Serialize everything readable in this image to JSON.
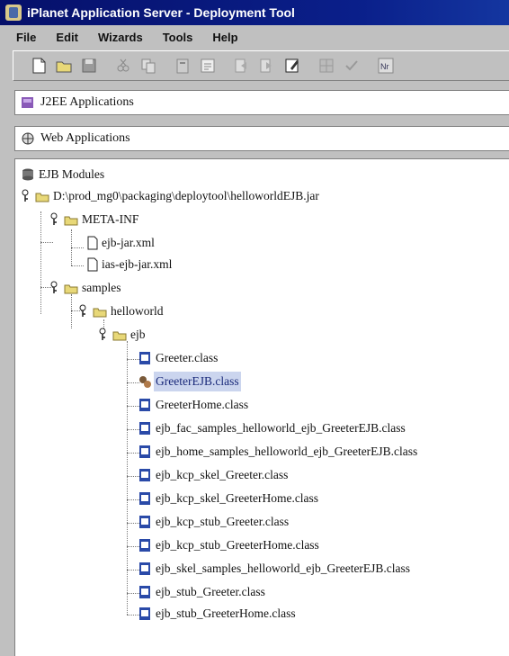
{
  "window": {
    "title": "iPlanet Application Server - Deployment Tool"
  },
  "menubar": {
    "items": [
      "File",
      "Edit",
      "Wizards",
      "Tools",
      "Help"
    ]
  },
  "toolbar": {
    "buttons": [
      "new-icon",
      "open-icon",
      "save-icon",
      "cut-icon",
      "copy-icon",
      "paste-icon",
      "compose-icon",
      "back-icon",
      "forward-icon",
      "edit-icon",
      "grid-icon",
      "check-icon",
      "deploy-icon"
    ]
  },
  "panels": {
    "j2ee": "J2EE Applications",
    "web": "Web Applications"
  },
  "tree": {
    "root": "EJB Modules",
    "jar": "D:\\prod_mg0\\packaging\\deploytool\\helloworldEJB.jar",
    "meta_inf": "META-INF",
    "meta_files": [
      "ejb-jar.xml",
      "ias-ejb-jar.xml"
    ],
    "samples": "samples",
    "helloworld": "helloworld",
    "ejb": "ejb",
    "selected": "GreeterEJB.class",
    "classes": [
      "Greeter.class",
      "GreeterEJB.class",
      "GreeterHome.class",
      "ejb_fac_samples_helloworld_ejb_GreeterEJB.class",
      "ejb_home_samples_helloworld_ejb_GreeterEJB.class",
      "ejb_kcp_skel_Greeter.class",
      "ejb_kcp_skel_GreeterHome.class",
      "ejb_kcp_stub_Greeter.class",
      "ejb_kcp_stub_GreeterHome.class",
      "ejb_skel_samples_helloworld_ejb_GreeterEJB.class",
      "ejb_stub_Greeter.class",
      "ejb_stub_GreeterHome.class"
    ]
  },
  "colors": {
    "titlebar": "#0a1f8a",
    "selection": "#cbd5ee",
    "folder": "#e8d878",
    "class_icon": "#2a4aa8"
  }
}
